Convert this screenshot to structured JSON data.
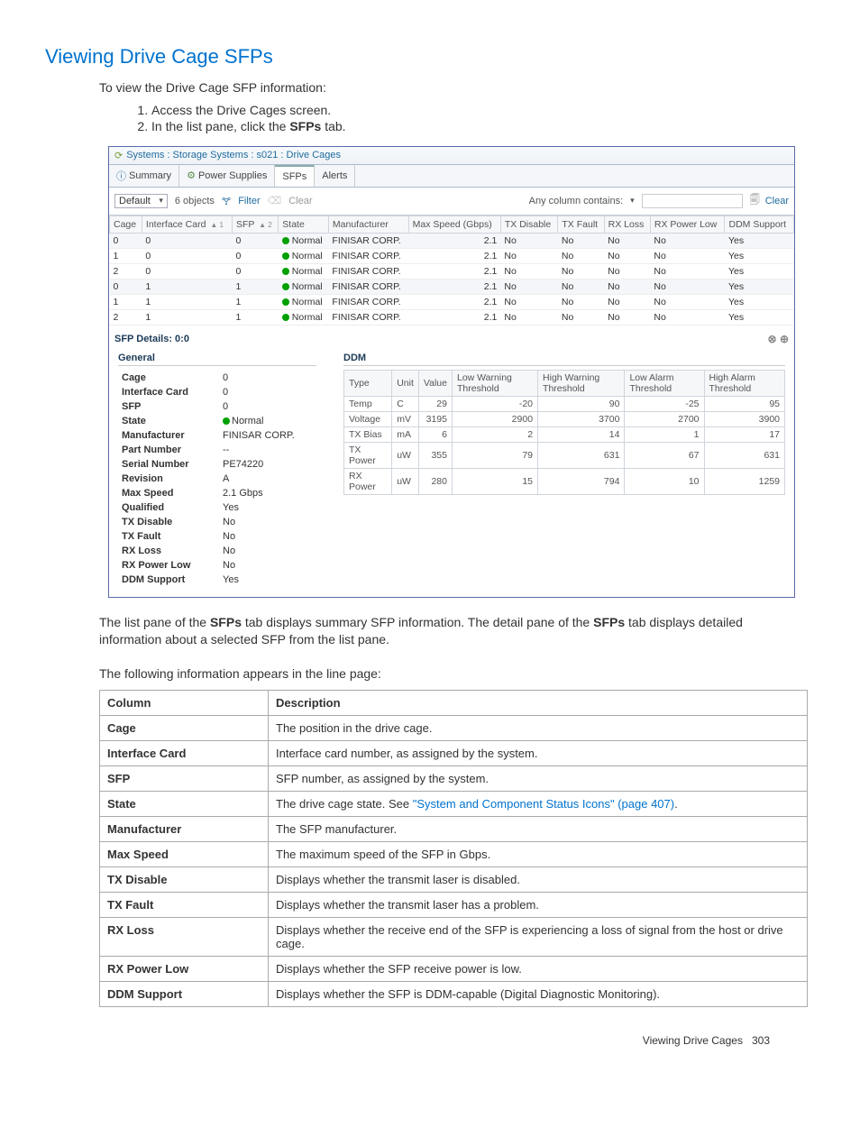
{
  "section": {
    "heading": "Viewing Drive Cage SFPs",
    "intro": "To view the Drive Cage SFP information:",
    "steps": [
      "Access the Drive Cages screen.",
      "In the list pane, click the SFPs tab."
    ],
    "after1_pre": "The list pane of the ",
    "after1_b1": "SFPs",
    "after1_mid": " tab displays summary SFP information. The detail pane of the ",
    "after1_b2": "SFPs",
    "after1_post": " tab displays detailed information about a selected SFP from the list pane.",
    "after2": "The following information appears in the line page:"
  },
  "ui": {
    "breadcrumb": "Systems : Storage Systems : s021 : Drive Cages",
    "tabs": [
      "Summary",
      "Power Supplies",
      "SFPs",
      "Alerts"
    ],
    "active_tab": "SFPs",
    "filter": {
      "default_label": "Default",
      "count": "6 objects",
      "filter_label": "Filter",
      "clear_label_muted": "Clear",
      "any_column": "Any column contains:",
      "clear_right": "Clear"
    },
    "grid_headers": [
      "Cage",
      "Interface Card",
      "SFP",
      "State",
      "Manufacturer",
      "Max Speed (Gbps)",
      "TX Disable",
      "TX Fault",
      "RX Loss",
      "RX Power Low",
      "DDM Support"
    ],
    "sort": {
      "interface": "▲ 1",
      "sfp": "▲ 2"
    },
    "grid_rows": [
      {
        "cage": "0",
        "ic": "0",
        "sfp": "0",
        "state": "Normal",
        "mfr": "FINISAR CORP.",
        "spd": "2.1",
        "txd": "No",
        "txf": "No",
        "rxl": "No",
        "rpl": "No",
        "ddm": "Yes",
        "alt": true
      },
      {
        "cage": "1",
        "ic": "0",
        "sfp": "0",
        "state": "Normal",
        "mfr": "FINISAR CORP.",
        "spd": "2.1",
        "txd": "No",
        "txf": "No",
        "rxl": "No",
        "rpl": "No",
        "ddm": "Yes",
        "alt": false
      },
      {
        "cage": "2",
        "ic": "0",
        "sfp": "0",
        "state": "Normal",
        "mfr": "FINISAR CORP.",
        "spd": "2.1",
        "txd": "No",
        "txf": "No",
        "rxl": "No",
        "rpl": "No",
        "ddm": "Yes",
        "alt": false
      },
      {
        "cage": "0",
        "ic": "1",
        "sfp": "1",
        "state": "Normal",
        "mfr": "FINISAR CORP.",
        "spd": "2.1",
        "txd": "No",
        "txf": "No",
        "rxl": "No",
        "rpl": "No",
        "ddm": "Yes",
        "alt": true
      },
      {
        "cage": "1",
        "ic": "1",
        "sfp": "1",
        "state": "Normal",
        "mfr": "FINISAR CORP.",
        "spd": "2.1",
        "txd": "No",
        "txf": "No",
        "rxl": "No",
        "rpl": "No",
        "ddm": "Yes",
        "alt": false
      },
      {
        "cage": "2",
        "ic": "1",
        "sfp": "1",
        "state": "Normal",
        "mfr": "FINISAR CORP.",
        "spd": "2.1",
        "txd": "No",
        "txf": "No",
        "rxl": "No",
        "rpl": "No",
        "ddm": "Yes",
        "alt": false
      }
    ],
    "details_title": "SFP Details: 0:0",
    "general_heading": "General",
    "general": [
      {
        "k": "Cage",
        "v": "0"
      },
      {
        "k": "Interface Card",
        "v": "0"
      },
      {
        "k": "SFP",
        "v": "0"
      },
      {
        "k": "State",
        "v": "Normal",
        "dot": true
      },
      {
        "k": "Manufacturer",
        "v": "FINISAR CORP."
      },
      {
        "k": "Part Number",
        "v": "--"
      },
      {
        "k": "Serial Number",
        "v": "PE74220"
      },
      {
        "k": "Revision",
        "v": "A"
      },
      {
        "k": "Max Speed",
        "v": "2.1 Gbps"
      },
      {
        "k": "Qualified",
        "v": "Yes"
      },
      {
        "k": "TX Disable",
        "v": "No"
      },
      {
        "k": "TX Fault",
        "v": "No"
      },
      {
        "k": "RX Loss",
        "v": "No"
      },
      {
        "k": "RX Power Low",
        "v": "No"
      },
      {
        "k": "DDM Support",
        "v": "Yes"
      }
    ],
    "ddm_heading": "DDM",
    "ddm_headers": [
      "Type",
      "Unit",
      "Value",
      "Low Warning Threshold",
      "High Warning Threshold",
      "Low Alarm Threshold",
      "High Alarm Threshold"
    ],
    "ddm_rows": [
      {
        "t": "Temp",
        "u": "C",
        "v": "29",
        "lw": "-20",
        "hw": "90",
        "la": "-25",
        "ha": "95"
      },
      {
        "t": "Voltage",
        "u": "mV",
        "v": "3195",
        "lw": "2900",
        "hw": "3700",
        "la": "2700",
        "ha": "3900"
      },
      {
        "t": "TX Bias",
        "u": "mA",
        "v": "6",
        "lw": "2",
        "hw": "14",
        "la": "1",
        "ha": "17"
      },
      {
        "t": "TX Power",
        "u": "uW",
        "v": "355",
        "lw": "79",
        "hw": "631",
        "la": "67",
        "ha": "631"
      },
      {
        "t": "RX Power",
        "u": "uW",
        "v": "280",
        "lw": "15",
        "hw": "794",
        "la": "10",
        "ha": "1259"
      }
    ]
  },
  "desc_table": {
    "head_col": "Column",
    "head_desc": "Description",
    "rows": [
      {
        "c": "Cage",
        "d": "The position in the drive cage."
      },
      {
        "c": "Interface Card",
        "d": "Interface card number, as assigned by the system."
      },
      {
        "c": "SFP",
        "d": "SFP number, as assigned by the system."
      },
      {
        "c": "State",
        "d": "The drive cage state. See ",
        "link": "\"System and Component Status Icons\" (page 407)",
        "post": "."
      },
      {
        "c": "Manufacturer",
        "d": "The SFP manufacturer."
      },
      {
        "c": "Max Speed",
        "d": "The maximum speed of the SFP in Gbps."
      },
      {
        "c": "TX Disable",
        "d": "Displays whether the transmit laser is disabled."
      },
      {
        "c": "TX Fault",
        "d": "Displays whether the transmit laser has a problem."
      },
      {
        "c": "RX Loss",
        "d": "Displays whether the receive end of the SFP is experiencing a loss of signal from the host or drive cage."
      },
      {
        "c": "RX Power Low",
        "d": "Displays whether the SFP receive power is low."
      },
      {
        "c": "DDM Support",
        "d": "Displays whether the SFP is DDM-capable (Digital Diagnostic Monitoring)."
      }
    ]
  },
  "footer": {
    "label": "Viewing Drive Cages",
    "page": "303"
  }
}
